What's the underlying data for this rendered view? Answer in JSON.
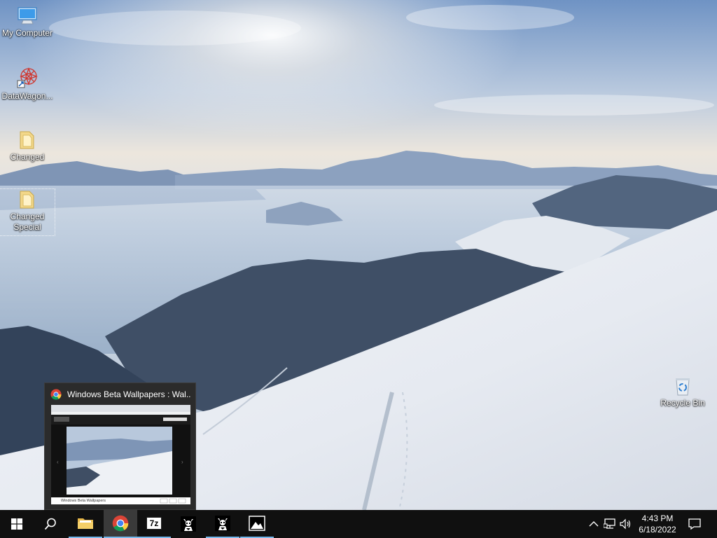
{
  "desktop": {
    "icons": [
      {
        "label": "My Computer",
        "icon": "computer-icon"
      },
      {
        "label": "DataWagon...",
        "icon": "datawagon-shortcut-icon"
      },
      {
        "label": "Changed",
        "icon": "folder-icon"
      },
      {
        "label": "Changed Special",
        "icon": "folder-icon"
      },
      {
        "label": "Recycle Bin",
        "icon": "recycle-bin-icon"
      }
    ]
  },
  "preview": {
    "title": "Windows Beta Wallpapers : Wal...",
    "icon": "chrome-icon",
    "page_tab_text": "Windows Beta Wallpapers"
  },
  "taskbar": {
    "buttons": [
      {
        "name": "start",
        "icon": "windows-logo-icon"
      },
      {
        "name": "search",
        "icon": "search-icon"
      },
      {
        "name": "file-explorer",
        "icon": "folder-icon",
        "running": true
      },
      {
        "name": "chrome",
        "icon": "chrome-icon",
        "running": true,
        "active": true
      },
      {
        "name": "7zip",
        "icon": "7zip-icon",
        "label": "7z",
        "running": true
      },
      {
        "name": "app-1",
        "icon": "character-icon"
      },
      {
        "name": "app-2",
        "icon": "character-icon",
        "running": true
      },
      {
        "name": "photos",
        "icon": "photos-icon",
        "running": true
      }
    ],
    "tray": {
      "time": "4:43 PM",
      "date": "6/18/2022",
      "icons": [
        "chevron-up-icon",
        "network-icon",
        "volume-icon",
        "notification-icon"
      ]
    }
  },
  "colors": {
    "taskbar": "#101010",
    "running_indicator": "#76b9ed",
    "active_button": "#3a3a3a"
  }
}
